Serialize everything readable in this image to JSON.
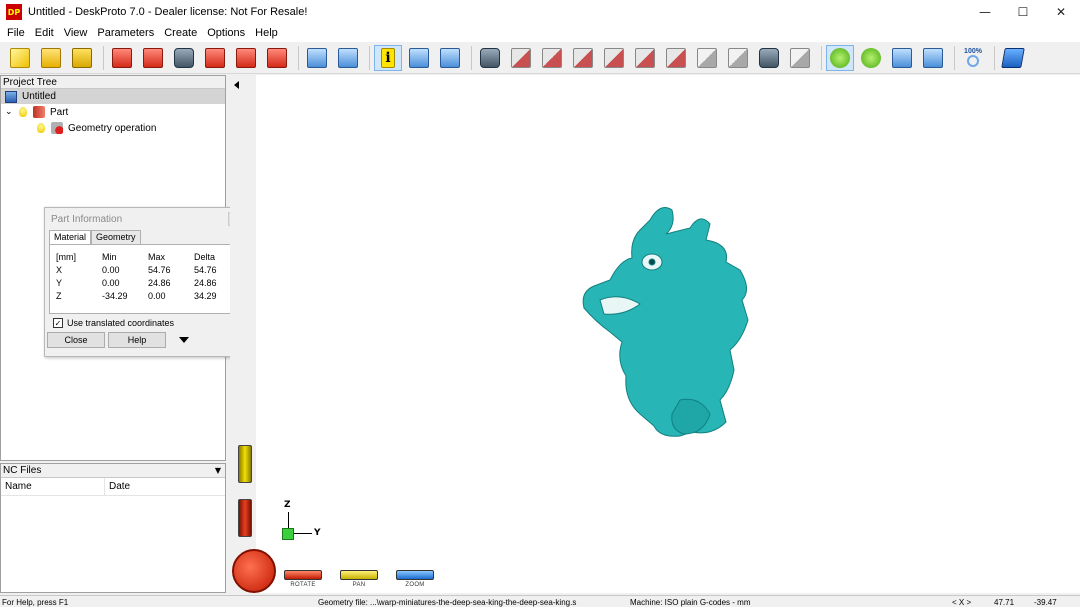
{
  "window": {
    "title": "Untitled - DeskProto 7.0 - Dealer license: Not For Resale!",
    "app_icon_text": "DP",
    "minimize": "—",
    "maximize": "☐",
    "close": "✕"
  },
  "menu": [
    "File",
    "Edit",
    "View",
    "Parameters",
    "Create",
    "Options",
    "Help"
  ],
  "toolbar": {
    "zoom_label": "100%",
    "info_glyph": "i"
  },
  "project_tree": {
    "header": "Project Tree",
    "root": "Untitled",
    "part": "Part",
    "operation": "Geometry operation",
    "expand_glyph": "⌄"
  },
  "nc_files": {
    "header": "NC Files",
    "dropdown_glyph": "▼",
    "col_name": "Name",
    "col_date": "Date"
  },
  "part_info": {
    "title": "Part Information",
    "tabs": [
      "Material",
      "Geometry"
    ],
    "headers": [
      "[mm]",
      "Min",
      "Max",
      "Delta"
    ],
    "rows": [
      [
        "X",
        "0.00",
        "54.76",
        "54.76"
      ],
      [
        "Y",
        "0.00",
        "24.86",
        "24.86"
      ],
      [
        "Z",
        "-34.29",
        "0.00",
        "34.29"
      ]
    ],
    "checkbox_label": "Use translated coordinates",
    "checkbox_glyph": "✓",
    "close_btn": "Close",
    "help_btn": "Help"
  },
  "viewport": {
    "axis_z": "Z",
    "axis_y": "Y",
    "controls": [
      "ROTATE",
      "PAN",
      "ZOOM"
    ],
    "model_color": "#27b5b5"
  },
  "status": {
    "help": "For Help, press F1",
    "geometry": "Geometry file: ...\\warp-miniatures-the-deep-sea-king-the-deep-sea-king.s",
    "machine": "Machine: ISO plain G-codes - mm",
    "xlabel": "< X >",
    "x": "47.71",
    "y": "-39.47"
  }
}
